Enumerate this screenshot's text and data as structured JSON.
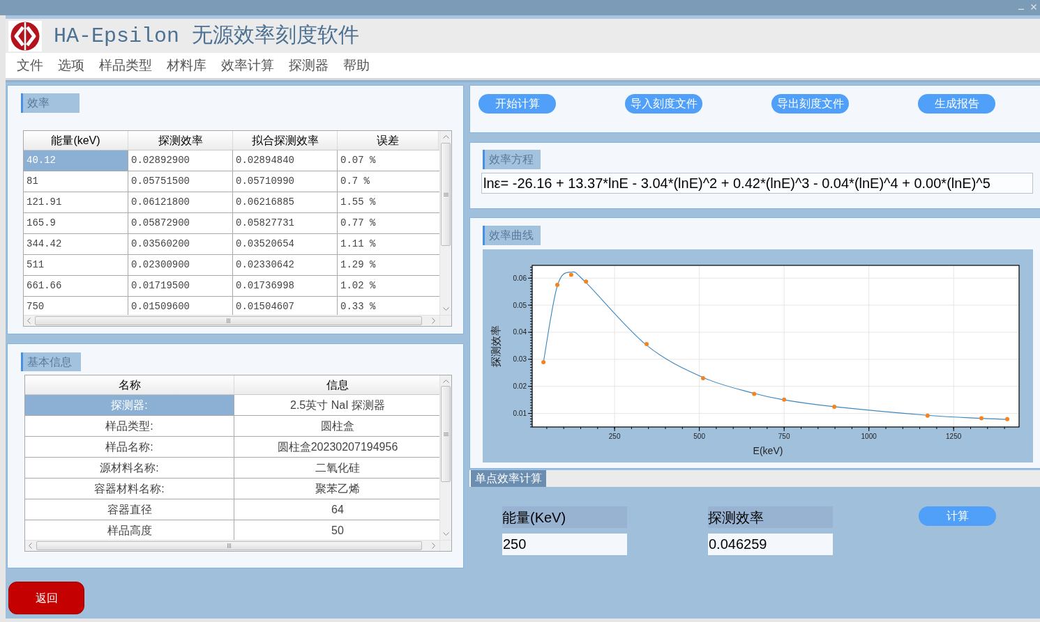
{
  "window": {
    "title": "HA-Epsilon 无源效率刻度软件"
  },
  "menu": [
    "文件",
    "选项",
    "样品类型",
    "材料库",
    "效率计算",
    "探测器",
    "帮助"
  ],
  "efficiency_panel": {
    "title": "效率",
    "table": {
      "columns": [
        "能量(keV)",
        "探测效率",
        "拟合探测效率",
        "误差"
      ],
      "rows": [
        {
          "cells": [
            "40.12",
            "0.02892900",
            "0.02894840",
            "0.07 %"
          ],
          "selected": true
        },
        {
          "cells": [
            "81",
            "0.05751500",
            "0.05710990",
            "0.7 %"
          ],
          "selected": false
        },
        {
          "cells": [
            "121.91",
            "0.06121800",
            "0.06216885",
            "1.55 %"
          ],
          "selected": false
        },
        {
          "cells": [
            "165.9",
            "0.05872900",
            "0.05827731",
            "0.77 %"
          ],
          "selected": false
        },
        {
          "cells": [
            "344.42",
            "0.03560200",
            "0.03520654",
            "1.11 %"
          ],
          "selected": false
        },
        {
          "cells": [
            "511",
            "0.02300900",
            "0.02330642",
            "1.29 %"
          ],
          "selected": false
        },
        {
          "cells": [
            "661.66",
            "0.01719500",
            "0.01736998",
            "1.02 %"
          ],
          "selected": false
        },
        {
          "cells": [
            "750",
            "0.01509600",
            "0.01504607",
            "0.33 %"
          ],
          "selected": false
        }
      ]
    }
  },
  "basic_info_panel": {
    "title": "基本信息",
    "table": {
      "columns": [
        "名称",
        "信息"
      ],
      "rows": [
        {
          "cells": [
            "探测器:",
            "2.5英寸 NaI 探测器"
          ],
          "selected": true
        },
        {
          "cells": [
            "样品类型:",
            "圆柱盒"
          ],
          "selected": false
        },
        {
          "cells": [
            "样品名称:",
            "圆柱盒20230207194956"
          ],
          "selected": false
        },
        {
          "cells": [
            "源材料名称:",
            "二氧化硅"
          ],
          "selected": false
        },
        {
          "cells": [
            "容器材料名称:",
            "聚苯乙烯"
          ],
          "selected": false
        },
        {
          "cells": [
            "容器直径",
            "64"
          ],
          "selected": false
        },
        {
          "cells": [
            "样品高度",
            "50"
          ],
          "selected": false
        }
      ]
    }
  },
  "back_button": "返回",
  "toolbar": {
    "buttons": [
      "开始计算",
      "导入刻度文件",
      "导出刻度文件",
      "生成报告"
    ]
  },
  "equation_panel": {
    "title": "效率方程",
    "equation": "lnε= -26.16 + 13.37*lnE - 3.04*(lnE)^2 + 0.42*(lnE)^3 - 0.04*(lnE)^4 + 0.00*(lnE)^5"
  },
  "curve_panel": {
    "title": "效率曲线",
    "chart_data": {
      "type": "line",
      "xlabel": "E(keV)",
      "ylabel": "探测效率",
      "x": [
        40.12,
        81,
        121.91,
        165.9,
        344.42,
        511,
        661.66,
        750,
        898,
        1173,
        1332,
        1408
      ],
      "series": [
        {
          "type": "line",
          "color": "#3a87c0",
          "values": [
            0.0289,
            0.0571,
            0.0622,
            0.0583,
            0.0352,
            0.0233,
            0.0174,
            0.015,
            0.0125,
            0.0093,
            0.0082,
            0.0078
          ]
        },
        {
          "type": "scatter",
          "color": "#f5841f",
          "values": [
            0.0289,
            0.0575,
            0.0612,
            0.0587,
            0.0356,
            0.023,
            0.0172,
            0.0151,
            0.0125,
            0.0092,
            0.0082,
            0.0079
          ]
        }
      ],
      "xlim": [
        7,
        1443
      ],
      "ylim": [
        0.005,
        0.0647
      ],
      "xticks": [
        250,
        500,
        750,
        1000,
        1250
      ],
      "yticks": [
        0.01,
        0.02,
        0.03,
        0.04,
        0.05,
        0.06
      ],
      "grid": true
    }
  },
  "single_point": {
    "title": "单点效率计算",
    "energy": {
      "label": "能量(KeV)",
      "value": "250"
    },
    "efficiency": {
      "label": "探测效率",
      "value": "0.046259"
    },
    "button": "计算"
  }
}
